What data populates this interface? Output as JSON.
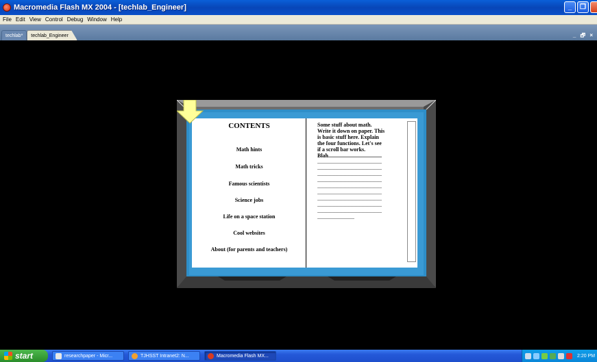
{
  "window": {
    "title": "Macromedia Flash MX 2004 - [techlab_Engineer]"
  },
  "menu": [
    "File",
    "Edit",
    "View",
    "Control",
    "Debug",
    "Window",
    "Help"
  ],
  "doc_tabs": [
    {
      "label": "techlab*",
      "active": false
    },
    {
      "label": "techlab_Engineer",
      "active": true
    }
  ],
  "doc_controls": "_ 🗗 ×",
  "book": {
    "contents_title": "CONTENTS",
    "toc": [
      "Math hints",
      "Math tricks",
      "Famous scientists",
      "Science jobs",
      "Life on a space station",
      "Cool websites",
      "About (for parents and teachers)"
    ],
    "text_lines": [
      "Some stuff about math.",
      "Write it down on paper.  This",
      "is basic stuff here.  Explain",
      "the four functions. Let's see",
      "if a scroll bar works."
    ],
    "blah_line": "Blah.......................................",
    "dotted_lines": [
      "...............................................",
      "...............................................",
      "...............................................",
      "...............................................",
      "...............................................",
      "...............................................",
      "...............................................",
      "...............................................",
      "...............................................",
      "..........................."
    ]
  },
  "taskbar": {
    "start_label": "start",
    "tasks": [
      {
        "label": "researchpaper - Micr...",
        "active": false
      },
      {
        "label": "TJHSST Intranet2: N...",
        "active": false
      },
      {
        "label": "Macromedia Flash MX...",
        "active": true
      }
    ],
    "clock": "2:20 PM"
  },
  "colors": {
    "frame_blue": "#2e8ec8",
    "arrow_yellow": "#ffff99",
    "frame_gray": "#6a6a6a"
  }
}
